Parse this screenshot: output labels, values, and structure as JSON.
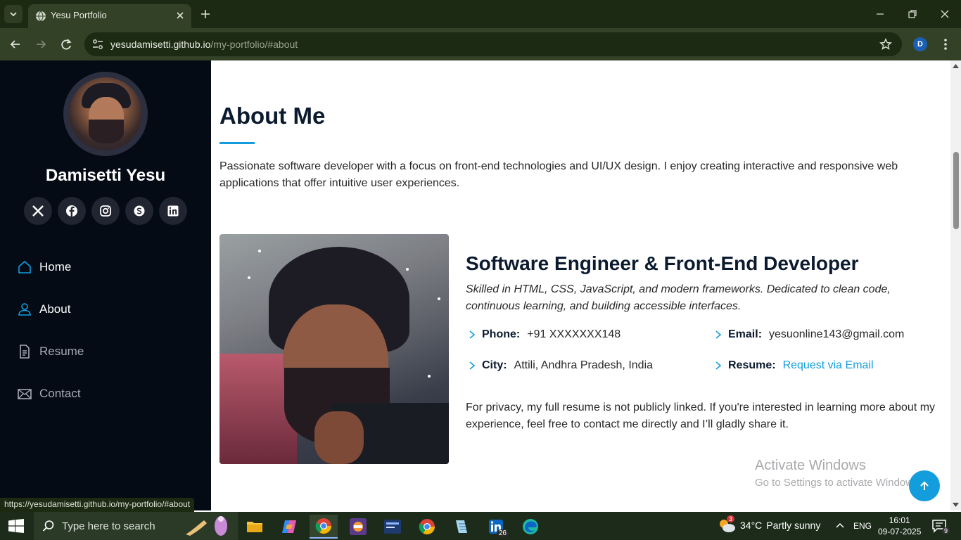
{
  "browser": {
    "tab_title": "Yesu Portfolio",
    "url_host": "yesudamisetti.github.io",
    "url_path": "/my-portfolio/#about",
    "profile_initial": "D",
    "status_url": "https://yesudamisetti.github.io/my-portfolio/#about"
  },
  "sidebar": {
    "name": "Damisetti Yesu",
    "socials": [
      "x-twitter-icon",
      "facebook-icon",
      "instagram-icon",
      "skype-icon",
      "linkedin-icon"
    ],
    "nav": [
      {
        "label": "Home",
        "icon": "house-icon"
      },
      {
        "label": "About",
        "icon": "person-icon"
      },
      {
        "label": "Resume",
        "icon": "file-text-icon"
      },
      {
        "label": "Contact",
        "icon": "envelope-icon"
      }
    ]
  },
  "about": {
    "title": "About Me",
    "intro": "Passionate software developer with a focus on front-end technologies and UI/UX design. I enjoy creating interactive and responsive web applications that offer intuitive user experiences.",
    "role_title": "Software Engineer & Front-End Developer",
    "role_desc": "Skilled in HTML, CSS, JavaScript, and modern frameworks. Dedicated to clean code, continuous learning, and building accessible interfaces.",
    "info": {
      "phone_label": "Phone:",
      "phone": "+91 XXXXXXX148",
      "email_label": "Email:",
      "email": "yesuonline143@gmail.com",
      "city_label": "City:",
      "city": "Attili, Andhra Pradesh, India",
      "resume_label": "Resume:",
      "resume": "Request via Email"
    },
    "privacy": "For privacy, my full resume is not publicly linked. If you're interested in learning more about my experience, feel free to contact me directly and I’ll gladly share it."
  },
  "watermark": {
    "line1": "Activate Windows",
    "line2": "Go to Settings to activate Windows."
  },
  "taskbar": {
    "search_placeholder": "Type here to search",
    "linkedin_badge": "26",
    "weather_badge": "3",
    "temperature": "34°C",
    "weather": "Partly sunny",
    "language": "ENG",
    "time": "16:01",
    "date": "09-07-2025",
    "notifications": "9"
  },
  "colors": {
    "accent": "#149ddd",
    "sidebar_bg": "#040b14",
    "chrome_dark": "#1c2913",
    "chrome_toolbar": "#334126"
  }
}
